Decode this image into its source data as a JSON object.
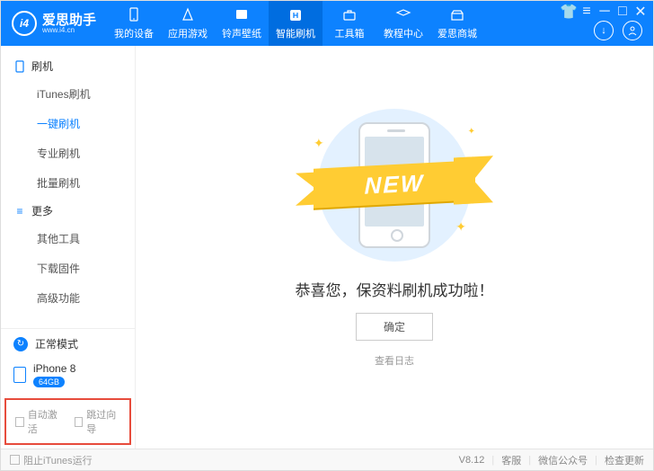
{
  "logo": {
    "icon_text": "i4",
    "title": "爱思助手",
    "subtitle": "www.i4.cn"
  },
  "nav": [
    {
      "label": "我的设备"
    },
    {
      "label": "应用游戏"
    },
    {
      "label": "铃声壁纸"
    },
    {
      "label": "智能刷机"
    },
    {
      "label": "工具箱"
    },
    {
      "label": "教程中心"
    },
    {
      "label": "爱思商城"
    }
  ],
  "sidebar": {
    "group1_label": "刷机",
    "group1_items": [
      "iTunes刷机",
      "一键刷机",
      "专业刷机",
      "批量刷机"
    ],
    "group2_label": "更多",
    "group2_items": [
      "其他工具",
      "下载固件",
      "高级功能"
    ],
    "mode_label": "正常模式",
    "device_name": "iPhone 8",
    "storage": "64GB",
    "cb1": "自动激活",
    "cb2": "跳过向导"
  },
  "main": {
    "banner_text": "NEW",
    "success_msg": "恭喜您，保资料刷机成功啦！",
    "ok_label": "确定",
    "log_label": "查看日志"
  },
  "footer": {
    "block_itunes": "阻止iTunes运行",
    "version": "V8.12",
    "support": "客服",
    "wechat": "微信公众号",
    "update": "检查更新"
  }
}
